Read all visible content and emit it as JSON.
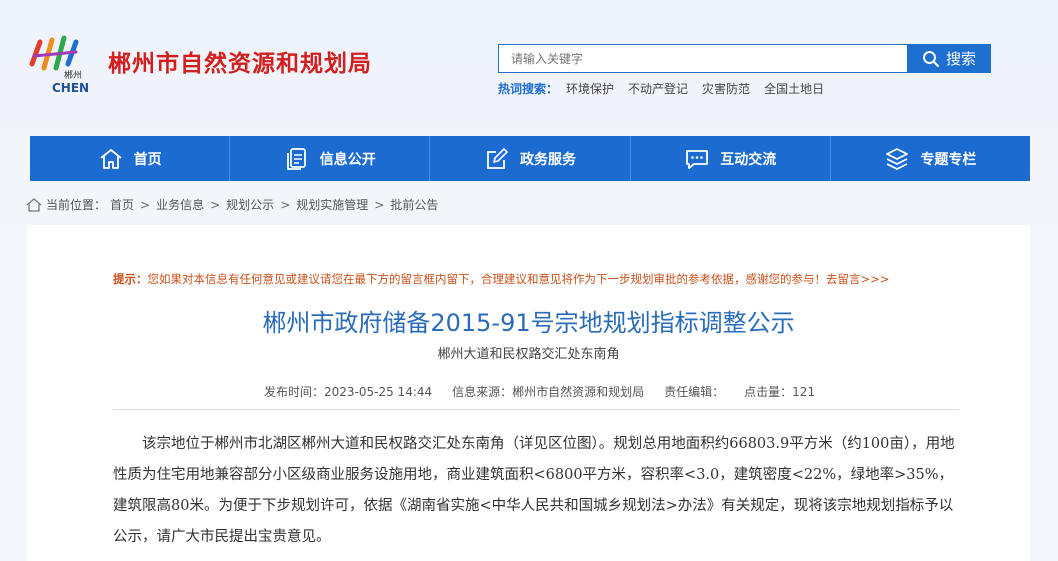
{
  "header": {
    "site_title": "郴州市自然资源和规划局",
    "logo_sub": "郴州",
    "logo_caption": "CHEN",
    "search_placeholder": "请输入关键字",
    "search_label": "搜索",
    "hot_label": "热词搜索：",
    "hot_items": [
      "环境保护",
      "不动产登记",
      "灾害防范",
      "全国土地日"
    ]
  },
  "nav": {
    "items": [
      {
        "label": "首页",
        "icon": "home-icon"
      },
      {
        "label": "信息公开",
        "icon": "document-icon"
      },
      {
        "label": "政务服务",
        "icon": "edit-icon"
      },
      {
        "label": "互动交流",
        "icon": "chat-icon"
      },
      {
        "label": "专题专栏",
        "icon": "layers-icon"
      }
    ]
  },
  "breadcrumb": {
    "label": "当前位置：",
    "items": [
      "首页",
      "业务信息",
      "规划公示",
      "规划实施管理",
      "批前公告"
    ]
  },
  "article": {
    "tip_label": "提示：",
    "tip_text": "您如果对本信息有任何意见或建议请您在最下方的留言框内留下，合理建议和意见将作为下一步规划审批的参考依据，感谢您的参与！去留言>>>",
    "title": "郴州市政府储备2015-91号宗地规划指标调整公示",
    "subtitle": "郴州大道和民权路交汇处东南角",
    "publish_time": "发布时间：2023-05-25 14:44",
    "source": "信息来源：郴州市自然资源和规划局",
    "editor": "责任编辑：",
    "clicks": "点击量：121",
    "body": "该宗地位于郴州市北湖区郴州大道和民权路交汇处东南角（详见区位图）。规划总用地面积约66803.9平方米（约100亩），用地性质为住宅用地兼容部分小区级商业服务设施用地，商业建筑面积<6800平方米，容积率<3.0，建筑密度<22%，绿地率>35%，建筑限高80米。为便于下步规划许可，依据《湖南省实施<中华人民共和国城乡规划法>办法》有关规定，现将该宗地规划指标予以公示，请广大市民提出宝贵意见。"
  },
  "colors": {
    "brand_red": "#d21f1f",
    "nav_blue": "#1c6bd1",
    "title_blue": "#2a6cb8",
    "tip_orange": "#c8511b"
  }
}
